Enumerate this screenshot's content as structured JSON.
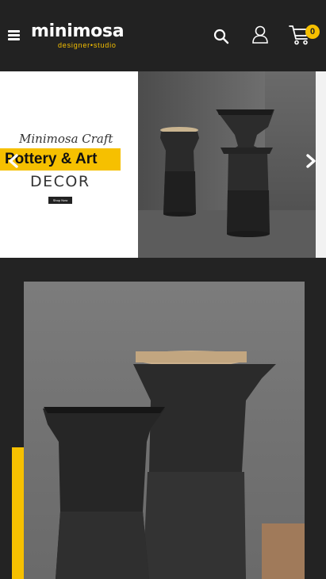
{
  "header": {
    "logo_main": "minimosa",
    "logo_sub": "designer•studio",
    "cart_count": "0"
  },
  "slider": {
    "script_title": "Minimosa Craft",
    "banner_title": "Pottery & Art",
    "decor_label": "DECOR",
    "shop_button": "Shop Now"
  },
  "icons": {
    "menu": "hamburger-menu-icon",
    "search": "search-icon",
    "user": "user-icon",
    "cart": "cart-icon",
    "prev": "chevron-left-icon",
    "next": "chevron-right-icon"
  },
  "colors": {
    "accent": "#f6c000",
    "background": "#222222"
  }
}
